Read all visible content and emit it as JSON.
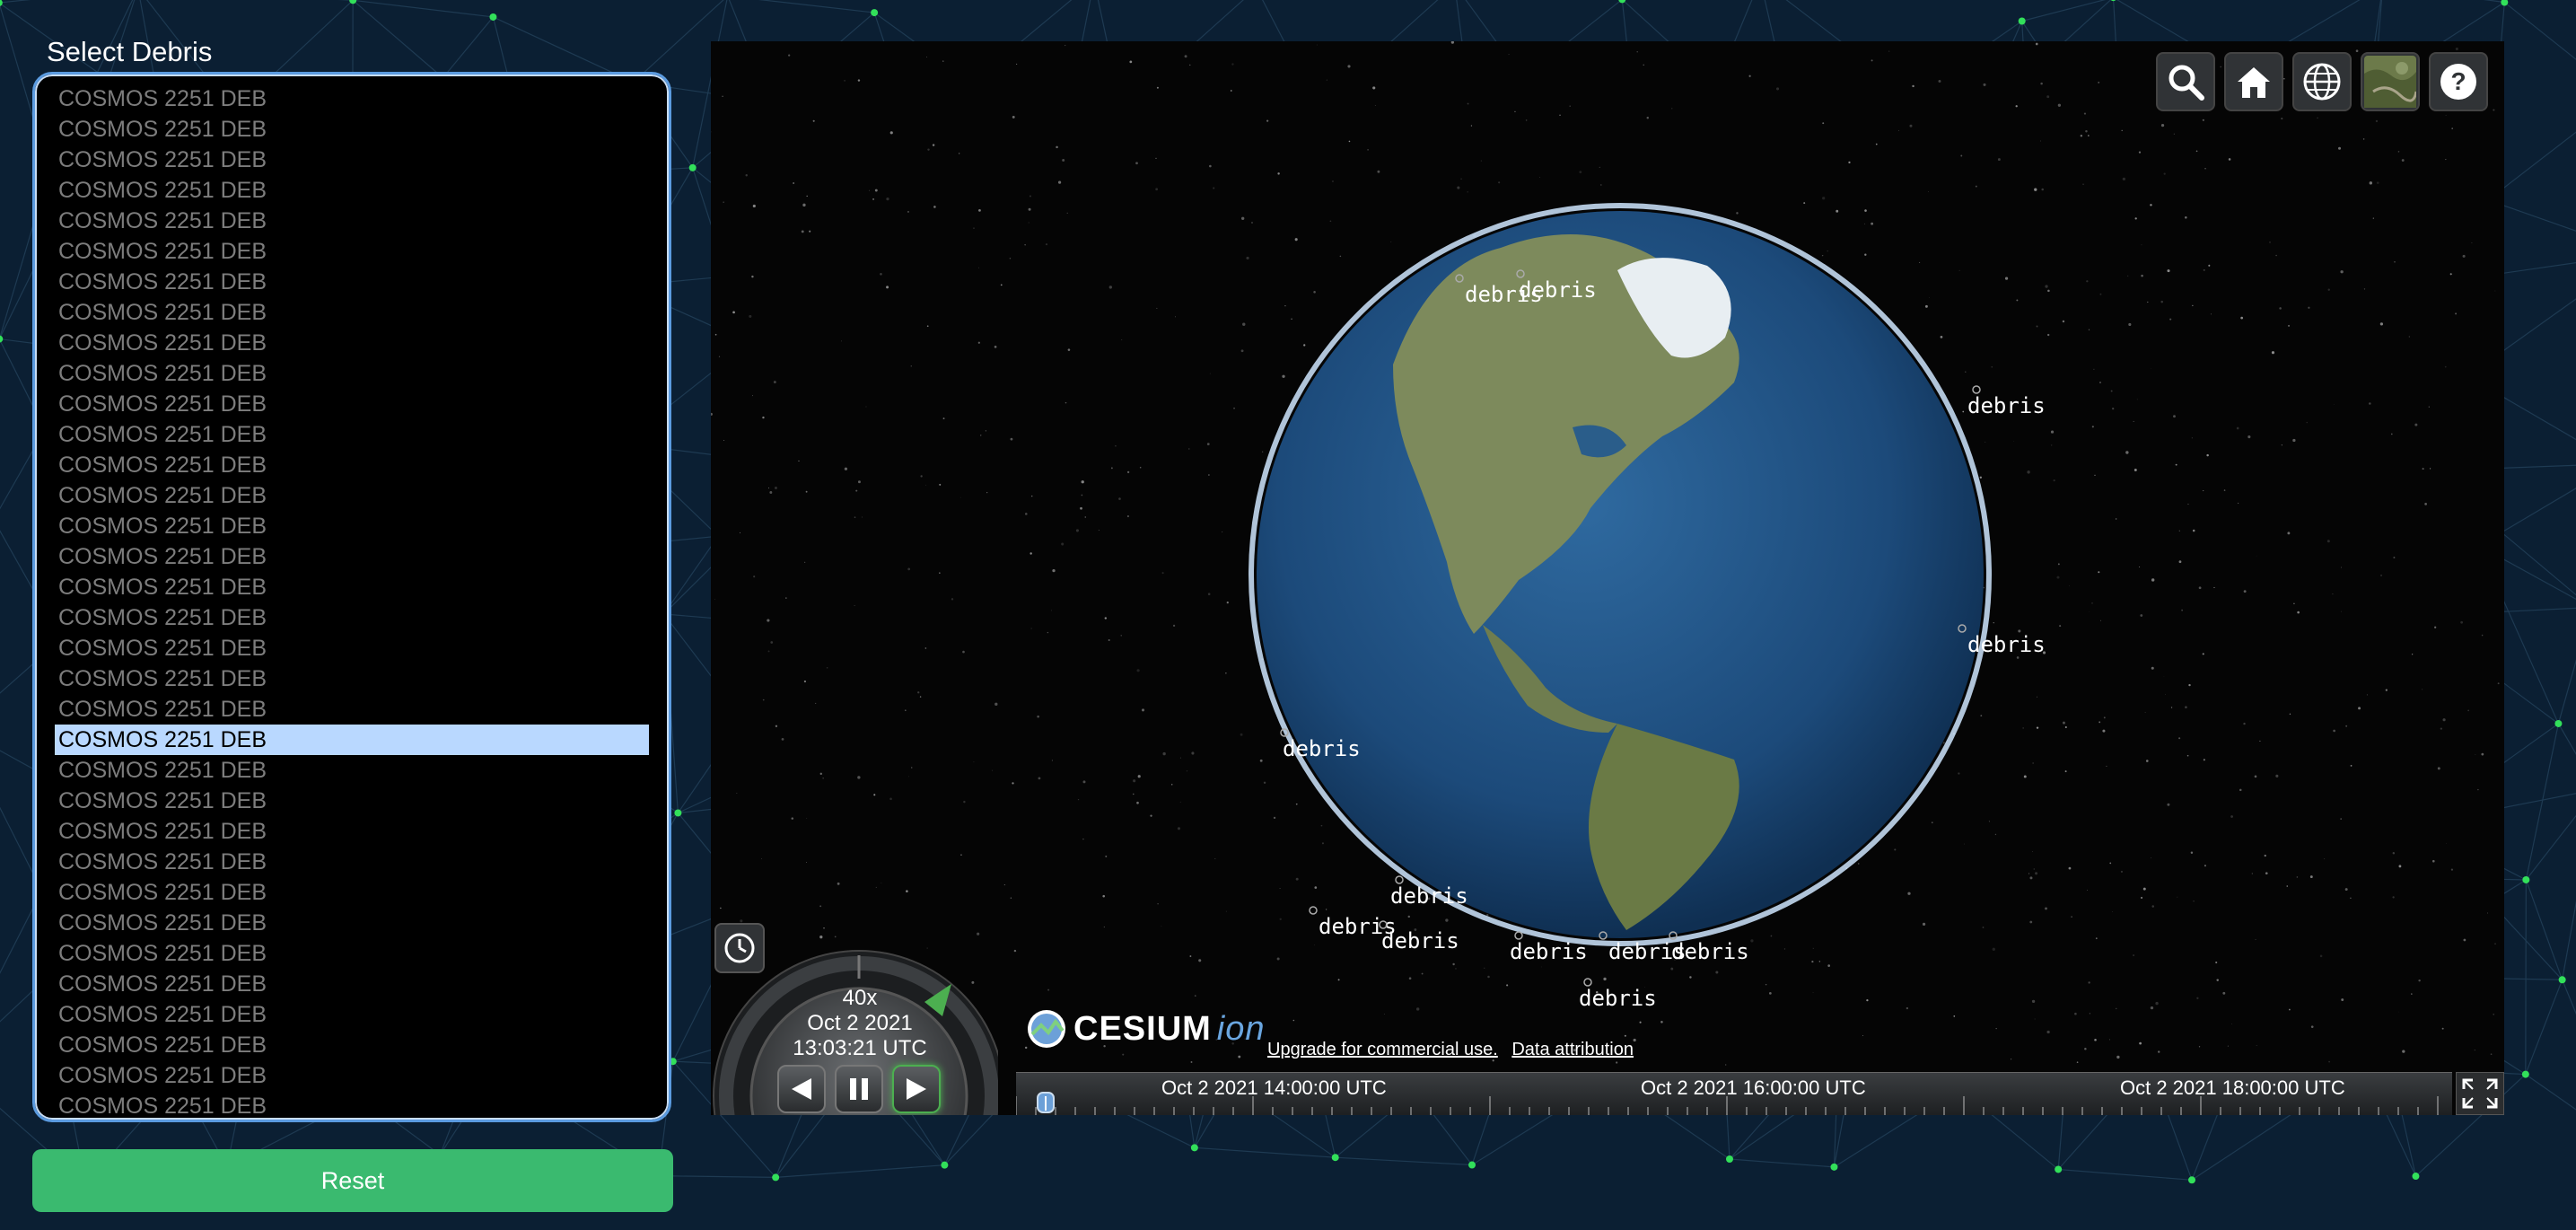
{
  "panel": {
    "title": "Select Debris",
    "items": [
      "COSMOS 2251 DEB",
      "COSMOS 2251 DEB",
      "COSMOS 2251 DEB",
      "COSMOS 2251 DEB",
      "COSMOS 2251 DEB",
      "COSMOS 2251 DEB",
      "COSMOS 2251 DEB",
      "COSMOS 2251 DEB",
      "COSMOS 2251 DEB",
      "COSMOS 2251 DEB",
      "COSMOS 2251 DEB",
      "COSMOS 2251 DEB",
      "COSMOS 2251 DEB",
      "COSMOS 2251 DEB",
      "COSMOS 2251 DEB",
      "COSMOS 2251 DEB",
      "COSMOS 2251 DEB",
      "COSMOS 2251 DEB",
      "COSMOS 2251 DEB",
      "COSMOS 2251 DEB",
      "COSMOS 2251 DEB",
      "COSMOS 2251 DEB",
      "COSMOS 2251 DEB",
      "COSMOS 2251 DEB",
      "COSMOS 2251 DEB",
      "COSMOS 2251 DEB",
      "COSMOS 2251 DEB",
      "COSMOS 2251 DEB",
      "COSMOS 2251 DEB",
      "COSMOS 2251 DEB",
      "COSMOS 2251 DEB",
      "COSMOS 2251 DEB",
      "COSMOS 2251 DEB",
      "COSMOS 2251 DEB"
    ],
    "selected_index": 21,
    "reset_label": "Reset"
  },
  "viewer": {
    "debris_label": "debris",
    "toolbar": [
      "search-icon",
      "home-icon",
      "globe-icon",
      "imagery-layer-icon",
      "help-icon"
    ],
    "logo_text": "CESIUM",
    "logo_suffix": "ion",
    "credit_upgrade": "Upgrade for commercial use.",
    "credit_attribution": "Data attribution",
    "animation": {
      "speed": "40x",
      "date": "Oct 2 2021",
      "time": "13:03:21 UTC"
    },
    "timeline_labels": [
      "Oct 2 2021 14:00:00 UTC",
      "Oct 2 2021 16:00:00 UTC",
      "Oct 2 2021 18:00:00 UTC"
    ]
  },
  "colors": {
    "background": "#0b1f33",
    "accent_green": "#3aba6f",
    "selection": "#b9d8ff",
    "list_border": "#5b9be0"
  }
}
